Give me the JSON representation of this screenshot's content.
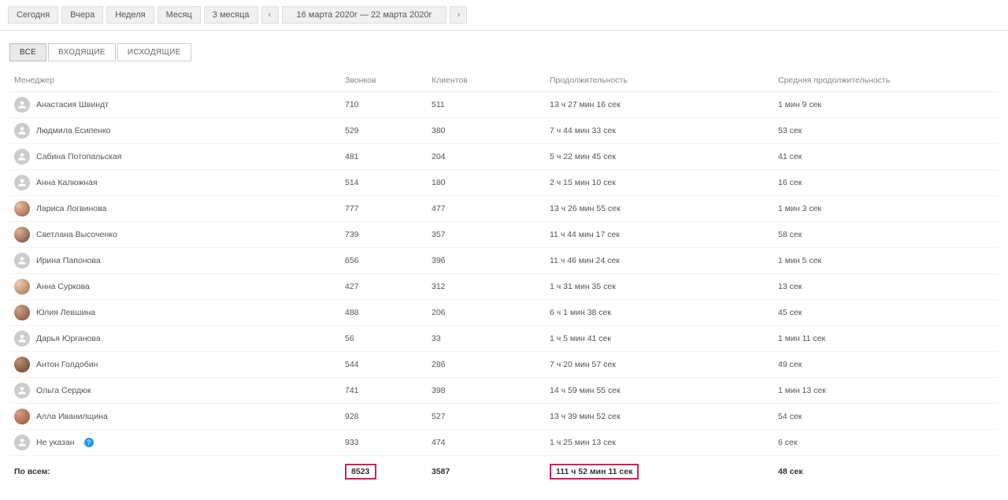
{
  "toolbar": {
    "today": "Сегодня",
    "yesterday": "Вчера",
    "week": "Неделя",
    "month": "Месяц",
    "three_months": "3 месяца",
    "range": "16 марта 2020г — 22 марта 2020г"
  },
  "tabs": {
    "all": "ВСЕ",
    "incoming": "ВХОДЯЩИЕ",
    "outgoing": "ИСХОДЯЩИЕ"
  },
  "headers": {
    "manager": "Менеджер",
    "calls": "Звонков",
    "clients": "Клиентов",
    "duration": "Продолжительность",
    "avg_duration": "Средняя продолжительность"
  },
  "rows": [
    {
      "name": "Анастасия Швиндт",
      "calls": "710",
      "clients": "511",
      "duration": "13 ч 27 мин 16 сек",
      "avg": "1 мин 9 сек",
      "avatar": "generic"
    },
    {
      "name": "Людмила Есипенко",
      "calls": "529",
      "clients": "380",
      "duration": "7 ч 44 мин 33 сек",
      "avg": "53 сек",
      "avatar": "generic"
    },
    {
      "name": "Сабина Потопальская",
      "calls": "481",
      "clients": "204",
      "duration": "5 ч 22 мин 45 сек",
      "avg": "41 сек",
      "avatar": "generic"
    },
    {
      "name": "Анна Калюжная",
      "calls": "514",
      "clients": "180",
      "duration": "2 ч 15 мин 10 сек",
      "avg": "16 сек",
      "avatar": "generic"
    },
    {
      "name": "Лариса Логвинова",
      "calls": "777",
      "clients": "477",
      "duration": "13 ч 26 мин 55 сек",
      "avg": "1 мин 3 сек",
      "avatar": "photo1"
    },
    {
      "name": "Светлана Высоченко",
      "calls": "739",
      "clients": "357",
      "duration": "11 ч 44 мин 17 сек",
      "avg": "58 сек",
      "avatar": "photo2"
    },
    {
      "name": "Ирина Папонова",
      "calls": "656",
      "clients": "396",
      "duration": "11 ч 46 мин 24 сек",
      "avg": "1 мин 5 сек",
      "avatar": "generic"
    },
    {
      "name": "Анна Суркова",
      "calls": "427",
      "clients": "312",
      "duration": "1 ч 31 мин 35 сек",
      "avg": "13 сек",
      "avatar": "photo3"
    },
    {
      "name": "Юлия Левшина",
      "calls": "488",
      "clients": "206",
      "duration": "6 ч 1 мин 38 сек",
      "avg": "45 сек",
      "avatar": "photo4"
    },
    {
      "name": "Дарья Юрганова",
      "calls": "56",
      "clients": "33",
      "duration": "1 ч 5 мин 41 сек",
      "avg": "1 мин 11 сек",
      "avatar": "generic"
    },
    {
      "name": "Антон Голдобин",
      "calls": "544",
      "clients": "286",
      "duration": "7 ч 20 мин 57 сек",
      "avg": "49 сек",
      "avatar": "photo5"
    },
    {
      "name": "Ольга Сердюк",
      "calls": "741",
      "clients": "398",
      "duration": "14 ч 59 мин 55 сек",
      "avg": "1 мин 13 сек",
      "avatar": "generic"
    },
    {
      "name": "Алла Иванилщина",
      "calls": "928",
      "clients": "527",
      "duration": "13 ч 39 мин 52 сек",
      "avg": "54 сек",
      "avatar": "photo6"
    },
    {
      "name": "Не указан",
      "calls": "933",
      "clients": "474",
      "duration": "1 ч 25 мин 13 сек",
      "avg": "6 сек",
      "avatar": "generic",
      "info": true
    }
  ],
  "totals": {
    "label": "По всем:",
    "calls": "8523",
    "clients": "3587",
    "duration": "111 ч 52 мин 11 сек",
    "avg": "48 сек"
  }
}
